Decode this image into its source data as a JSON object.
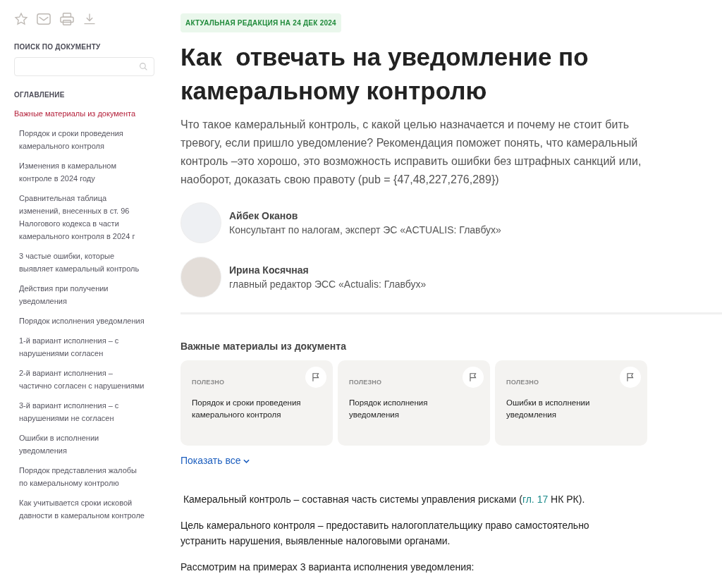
{
  "sidebar": {
    "search": {
      "label": "ПОИСК ПО ДОКУМЕНТУ"
    },
    "toc_heading": "ОГЛАВЛЕНИЕ",
    "toc": [
      {
        "label": "Важные материалы из документа",
        "selected": true,
        "children": [
          {
            "label": "Порядок и сроки проведения камерального контроля",
            "selected": false
          },
          {
            "label": "Изменения в камеральном контроле в 2024 году",
            "selected": false
          },
          {
            "label": "Сравнительная таблица изменений, внесенных в ст. 96 Налогового кодекса в части камерального контроля в 2024 г",
            "selected": false
          },
          {
            "label": "3 частые ошибки, которые выявляет камеральный контроль",
            "selected": false
          },
          {
            "label": "Действия при получении уведомления",
            "selected": false
          },
          {
            "label": "Порядок исполнения уведомления",
            "selected": false
          },
          {
            "label": "1-й вариант исполнения – с нарушениями согласен",
            "selected": false
          },
          {
            "label": "2-й вариант исполнения – частично согласен с нарушениями",
            "selected": false
          },
          {
            "label": "3-й вариант исполнения – с нарушениями не согласен",
            "selected": false
          },
          {
            "label": "Ошибки в исполнении уведомления",
            "selected": false
          },
          {
            "label": "Порядок представления жалобы по камеральному контролю",
            "selected": false
          },
          {
            "label": "Как учитывается сроки исковой давности в камеральном контроле",
            "selected": false
          }
        ]
      }
    ]
  },
  "article": {
    "badge": "АКТУАЛЬНАЯ РЕДАКЦИЯ НА 24 ДЕК 2024",
    "title": "Как  отвечать на уведомление по камеральному контролю",
    "lead": "Что такое камеральный контроль, с какой целью назначается и почему не стоит бить тревогу, если пришло уведомление? Рекомендация поможет понять, что камеральный контроль –это хорошо, это возможность исправить ошибки без штрафных санкций или, наоборот, доказать свою правоту (pub = {47,48,227,276,289})",
    "authors": [
      {
        "kind": "illustration",
        "name": "Айбек Оканов",
        "role": "Консультант по налогам, эксперт ЭС «ACTUALIS: Главбух»"
      },
      {
        "kind": "photo",
        "name": "Ирина Косячная",
        "role": "главный редактор ЭСС «Actualis: Главбух»"
      }
    ],
    "materials": {
      "heading": "Важные материалы из документа",
      "cards": [
        {
          "tag": "ПОЛЕЗНО",
          "text": "Порядок и сроки проведения камерального контроля"
        },
        {
          "tag": "ПОЛЕЗНО",
          "text": "Порядок исполнения уведомления"
        },
        {
          "tag": "ПОЛЕЗНО",
          "text": "Ошибки в исполнении уведомления"
        }
      ],
      "show_all": "Показать все"
    },
    "paragraphs": [
      {
        "parts": [
          {
            "text": " Камеральный контроль – составная часть системы управления рисками ("
          },
          {
            "text": "гл. 17",
            "link": true
          },
          {
            "text": " НК РК)."
          }
        ]
      },
      {
        "parts": [
          {
            "text": "Цель камерального контроля – предоставить налогоплательщику право самостоятельно устранить нарушения, выявленные налоговыми органами."
          }
        ]
      },
      {
        "parts": [
          {
            "text": "Рассмотрим на примерах 3 варианта исполнения уведомления:"
          }
        ]
      }
    ]
  }
}
